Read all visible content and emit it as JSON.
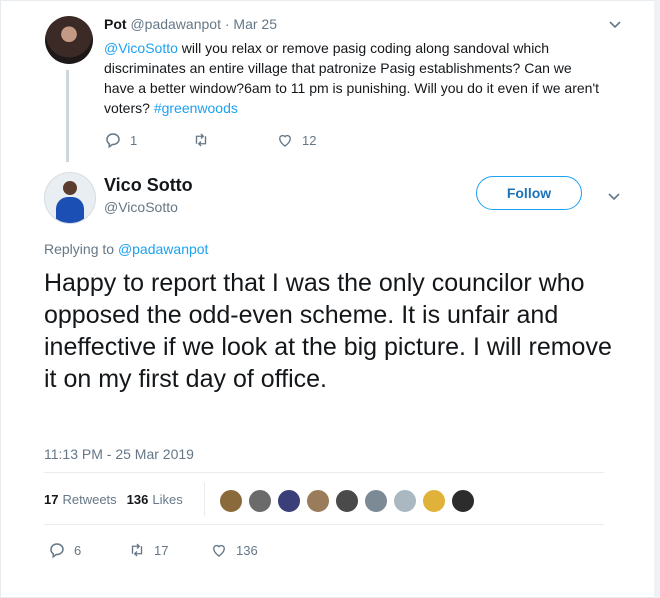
{
  "parent": {
    "name": "Pot",
    "handle": "@padawanpot",
    "separator": "·",
    "date": "Mar 25",
    "text_mention": "@VicoSotto",
    "text_body": " will you relax or remove pasig coding along sandoval which discriminates an entire village that patronize Pasig establishments? Can we have a better window?6am to 11 pm is punishing. Will you do it even if we aren't voters? ",
    "text_hashtag": "#greenwoods",
    "replies": "1",
    "retweets": "",
    "likes": "12"
  },
  "tweet": {
    "name": "Vico Sotto",
    "handle": "@VicoSotto",
    "follow_label": "Follow",
    "replying_label": "Replying to",
    "replying_handle": "@padawanpot",
    "text": "Happy to report that I was the only councilor who opposed the odd-even scheme. It is unfair and ineffective if we look at the big picture. I will remove it on my first day of office.",
    "timestamp": "11:13 PM - 25 Mar 2019",
    "retweet_count": "17",
    "retweet_label": "Retweets",
    "like_count": "136",
    "like_label": "Likes",
    "replies": "6",
    "retweets": "17",
    "likes": "136"
  },
  "icons": {
    "reply": "reply-icon",
    "retweet": "retweet-icon",
    "like": "heart-icon",
    "more": "chevron-down-icon"
  },
  "colors": {
    "link": "#1da1f2",
    "follow": "#1da1f2",
    "text": "#14171a",
    "muted": "#657786"
  },
  "likers": [
    {
      "color": "#8a6a3a"
    },
    {
      "color": "#6b6b6b"
    },
    {
      "color": "#3a3f7a"
    },
    {
      "color": "#9a7b5a"
    },
    {
      "color": "#4a4a4a"
    },
    {
      "color": "#7c8a96"
    },
    {
      "color": "#aab8c2"
    },
    {
      "color": "#e0b23a"
    },
    {
      "color": "#2c2c2c"
    }
  ]
}
